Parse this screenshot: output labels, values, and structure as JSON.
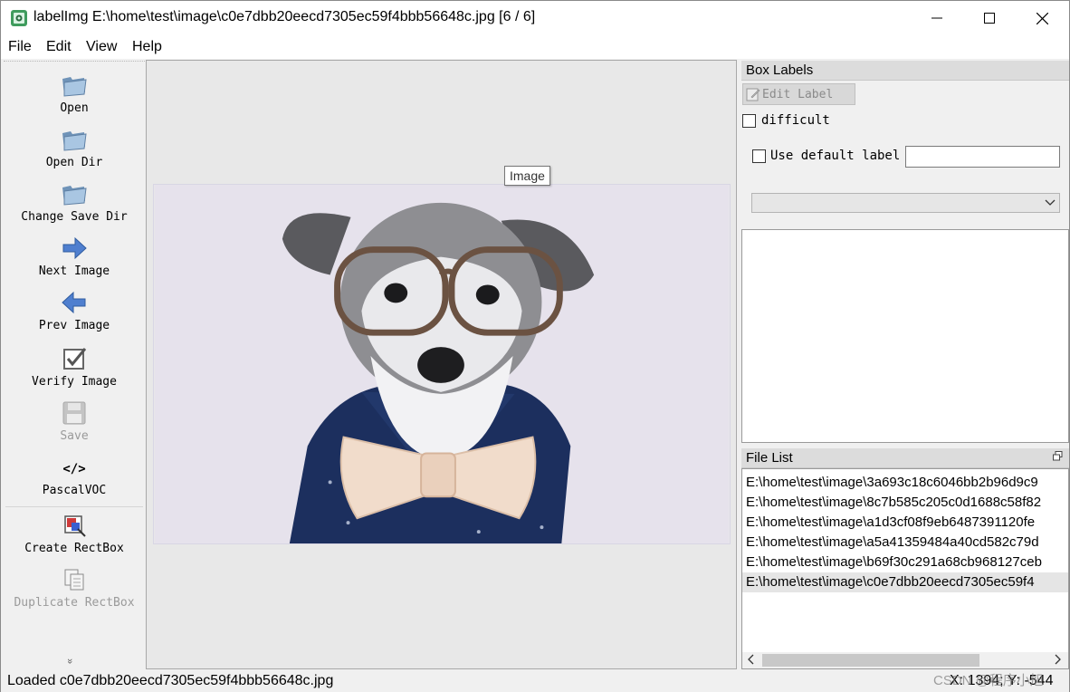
{
  "window": {
    "title": "labelImg E:\\home\\test\\image\\c0e7dbb20eecd7305ec59f4bbb56648c.jpg [6 / 6]",
    "minimize": "—",
    "maximize": "☐",
    "close": "✕"
  },
  "menu": [
    "File",
    "Edit",
    "View",
    "Help"
  ],
  "toolbar": {
    "open": "Open",
    "open_dir": "Open Dir",
    "change_save_dir": "Change Save Dir",
    "next_image": "Next Image",
    "prev_image": "Prev Image",
    "verify_image": "Verify Image",
    "save": "Save",
    "format_icon_text": "</>",
    "format": "PascalVOC",
    "create_rectbox": "Create RectBox",
    "duplicate_rectbox": "Duplicate RectBox",
    "more": "»"
  },
  "canvas": {
    "tooltip": "Image",
    "image_description": "dog"
  },
  "box_labels": {
    "title": "Box Labels",
    "edit_label": "Edit Label",
    "difficult": "difficult",
    "use_default_label": "Use default label",
    "default_label_value": ""
  },
  "file_list": {
    "title": "File List",
    "files": [
      "E:\\home\\test\\image\\3a693c18c6046bb2b96d9c9",
      "E:\\home\\test\\image\\8c7b585c205c0d1688c58f82",
      "E:\\home\\test\\image\\a1d3cf08f9eb6487391120fe",
      "E:\\home\\test\\image\\a5a41359484a40cd582c79d",
      "E:\\home\\test\\image\\b69f30c291a68cb968127ceb",
      "E:\\home\\test\\image\\c0e7dbb20eecd7305ec59f4"
    ],
    "selected_index": 5
  },
  "status": {
    "message": "Loaded c0e7dbb20eecd7305ec59f4bbb56648c.jpg",
    "coords": "X: 1394; Y: -544",
    "watermark": "CSDN @程序小旭"
  },
  "colors": {
    "photo_background": "#e6e2ec",
    "shirt": "#1c2f5e",
    "bow_tie": "#f1dccb"
  }
}
